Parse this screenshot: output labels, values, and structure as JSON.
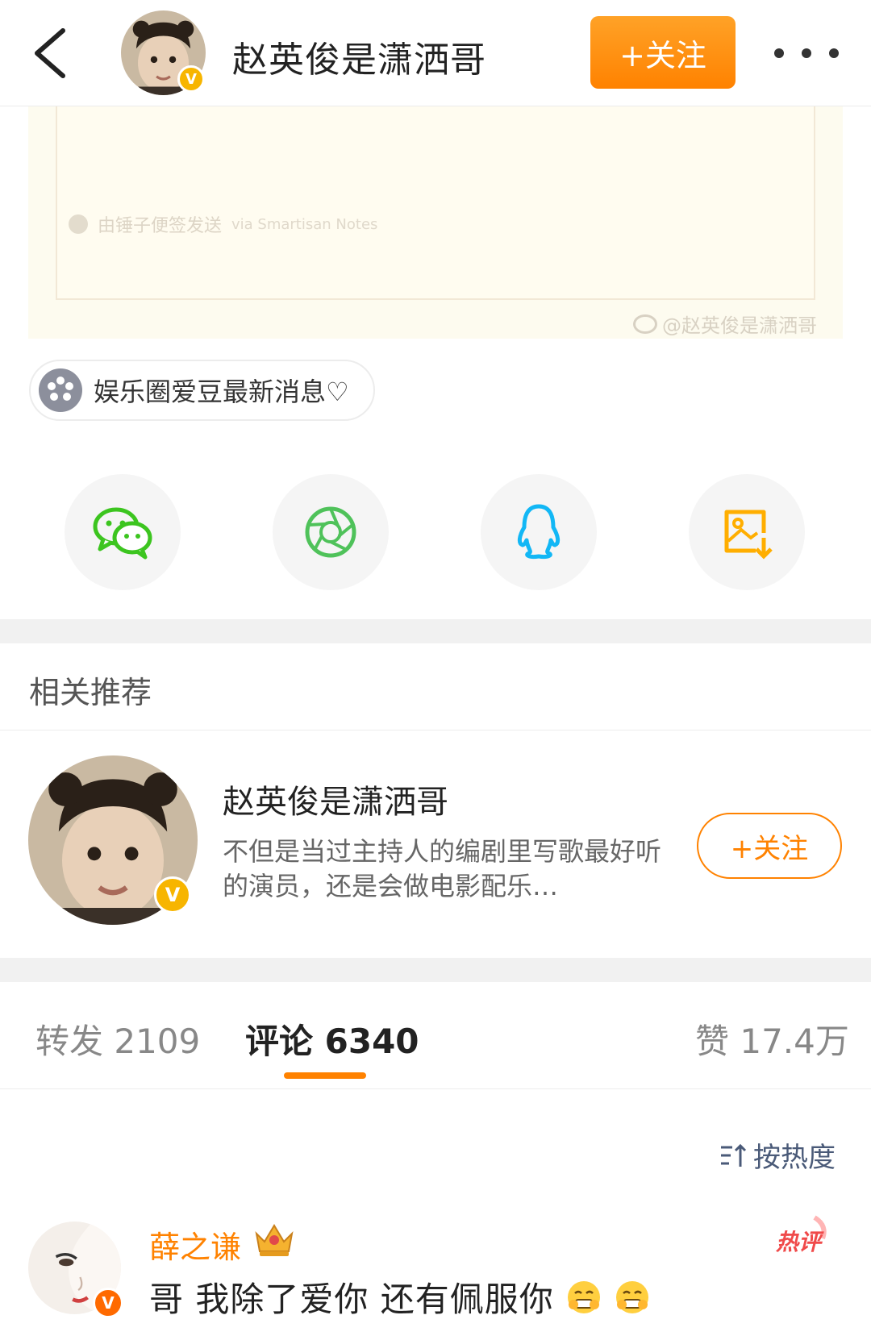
{
  "header": {
    "title": "赵英俊是潇洒哥",
    "follow_label": "+关注",
    "verified_badge": "V"
  },
  "note_image": {
    "caption_cn": "由锤子便签发送",
    "caption_en": "via Smartisan Notes",
    "watermark": "@赵英俊是潇洒哥"
  },
  "topic": {
    "label": "娱乐圈爱豆最新消息♡"
  },
  "share": [
    {
      "name": "wechat-icon",
      "color": "#3cc51f"
    },
    {
      "name": "moments-icon",
      "color": "#4fc25a"
    },
    {
      "name": "qq-icon",
      "color": "#12b7f5"
    },
    {
      "name": "save-image-icon",
      "color": "#ffae00"
    }
  ],
  "recommend": {
    "section_title": "相关推荐",
    "name": "赵英俊是潇洒哥",
    "description": "不但是当过主持人的编剧里写歌最好听的演员，还是会做电影配乐…",
    "follow_label": "+关注",
    "verified_badge": "V"
  },
  "tabs": {
    "repost": "转发 2109",
    "comment": "评论 6340",
    "like": "赞 17.4万",
    "active": "comment"
  },
  "sort": {
    "label": "按热度"
  },
  "comment": {
    "user": "薛之谦",
    "badge": "V",
    "hot_label": "热评",
    "text": "哥 我除了爱你 还有佩服你"
  },
  "colors": {
    "accent": "#ff8200",
    "verified": "#f7b500",
    "link": "#4a5a78"
  }
}
